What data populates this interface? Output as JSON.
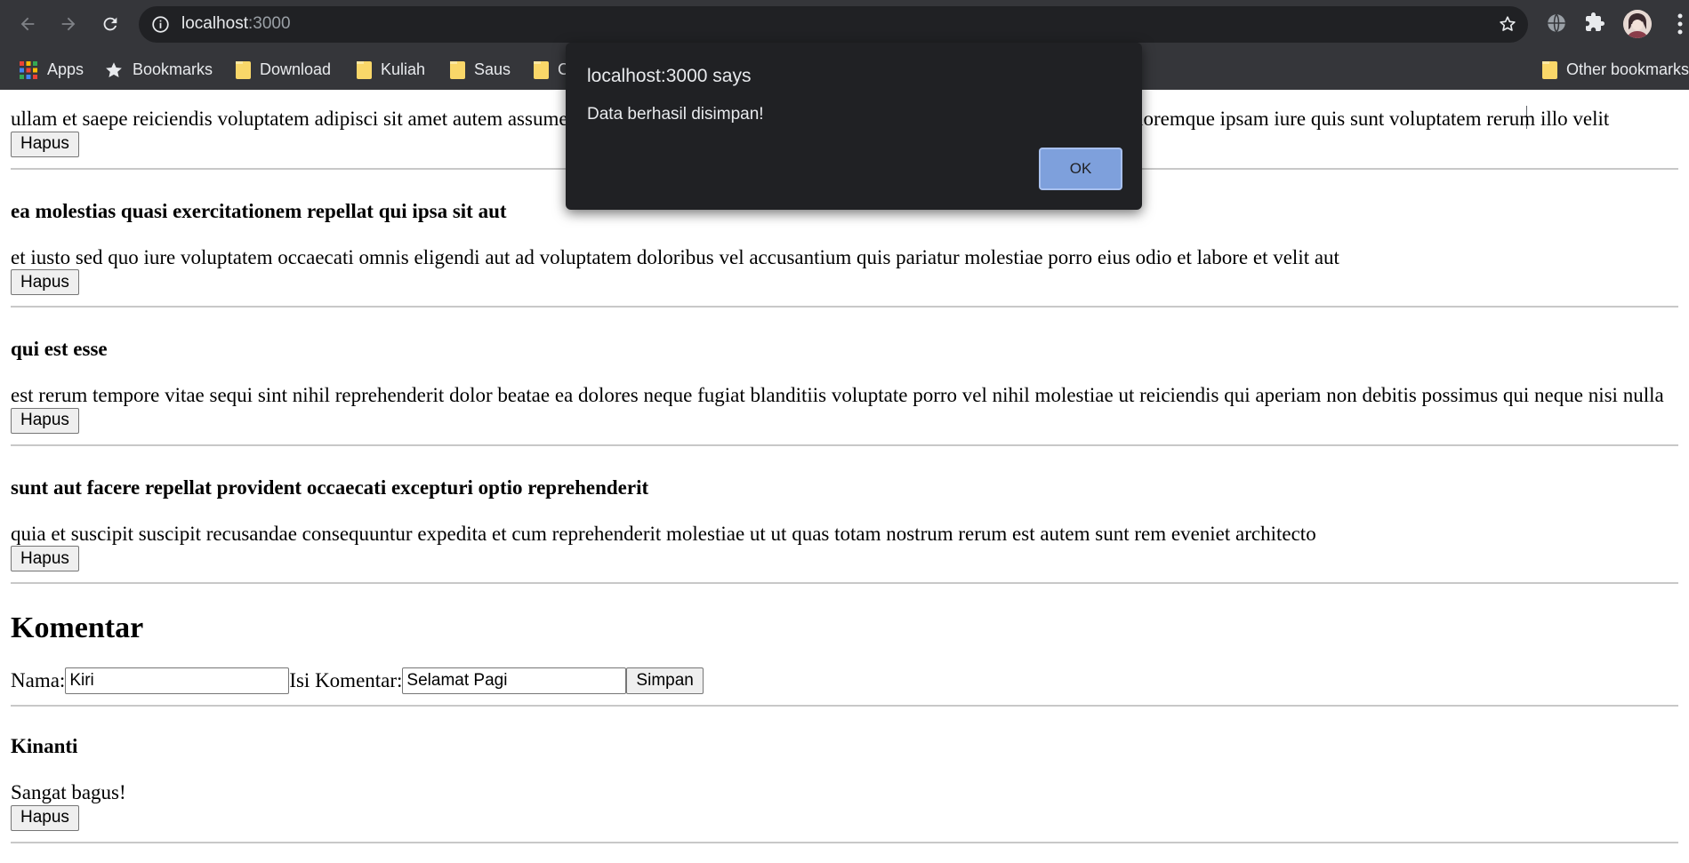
{
  "browser": {
    "url_host": "localhost",
    "url_port": ":3000",
    "bookmarks": [
      {
        "label": "Apps",
        "icon": "apps-grid-icon"
      },
      {
        "label": "Bookmarks",
        "icon": "star-icon"
      },
      {
        "label": "Download",
        "icon": "folder-icon"
      },
      {
        "label": "Kuliah",
        "icon": "folder-icon"
      },
      {
        "label": "Saus",
        "icon": "folder-icon"
      },
      {
        "label": "C",
        "icon": "folder-icon"
      }
    ],
    "other_bookmarks": "Other bookmarks"
  },
  "posts": [
    {
      "title": "",
      "body_left": "ullam et saepe reiciendis voluptatem adipisci sit amet autem assume",
      "body_right": "loremque ipsam iure quis sunt voluptatem rerum illo velit",
      "delete_label": "Hapus"
    },
    {
      "title": "ea molestias quasi exercitationem repellat qui ipsa sit aut",
      "body": "et iusto sed quo iure voluptatem occaecati omnis eligendi aut ad voluptatem doloribus vel accusantium quis pariatur molestiae porro eius odio et labore et velit aut",
      "delete_label": "Hapus"
    },
    {
      "title": "qui est esse",
      "body": "est rerum tempore vitae sequi sint nihil reprehenderit dolor beatae ea dolores neque fugiat blanditiis voluptate porro vel nihil molestiae ut reiciendis qui aperiam non debitis possimus qui neque nisi nulla",
      "delete_label": "Hapus"
    },
    {
      "title": "sunt aut facere repellat provident occaecati excepturi optio reprehenderit",
      "body": "quia et suscipit suscipit recusandae consequuntur expedita et cum reprehenderit molestiae ut ut quas totam nostrum rerum est autem sunt rem eveniet architecto",
      "delete_label": "Hapus"
    }
  ],
  "komentar": {
    "heading": "Komentar",
    "name_label": "Nama:",
    "name_value": "Kiri",
    "comment_label": "Isi Komentar:",
    "comment_value": "Selamat Pagi",
    "submit_label": "Simpan"
  },
  "comments": [
    {
      "name": "Kinanti",
      "text": "Sangat bagus!",
      "delete_label": "Hapus"
    }
  ],
  "dialog": {
    "title": "localhost:3000 says",
    "message": "Data berhasil disimpan!",
    "ok_label": "OK"
  }
}
